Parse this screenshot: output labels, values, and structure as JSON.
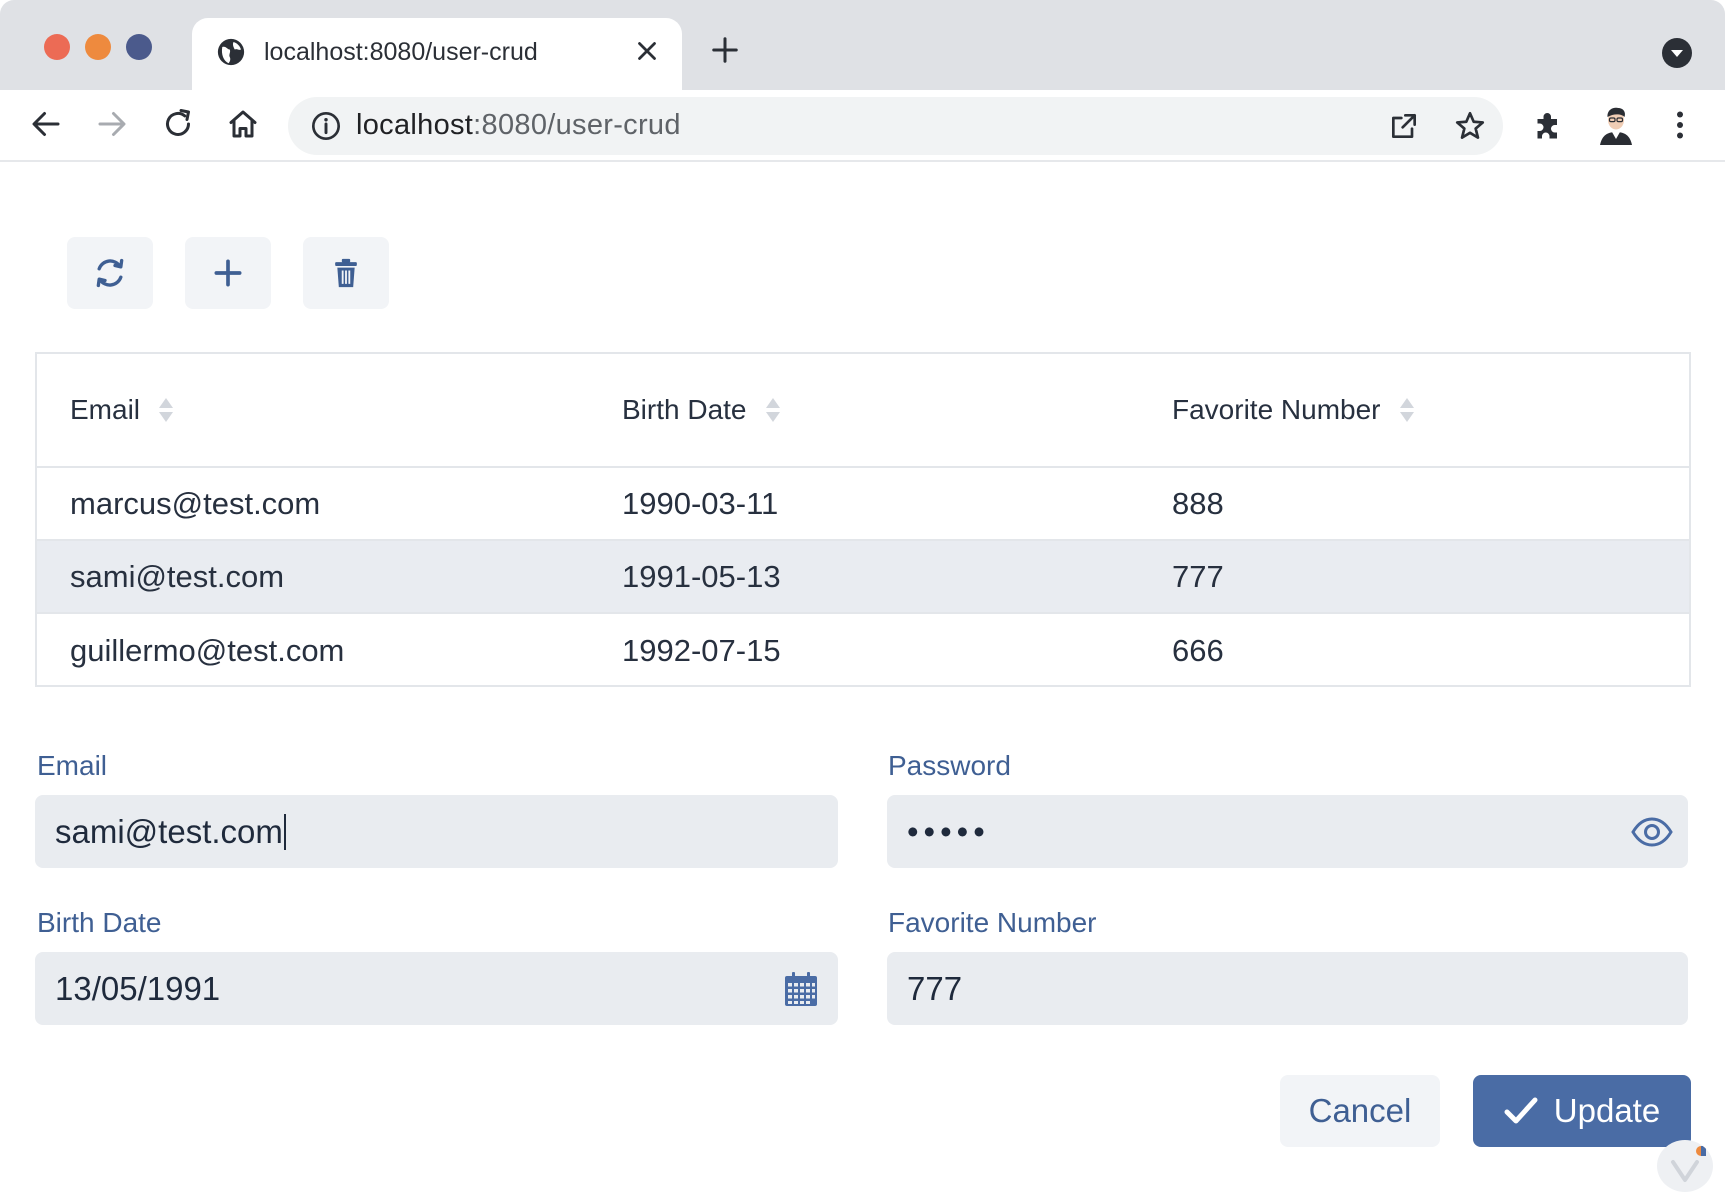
{
  "browser": {
    "tab_title": "localhost:8080/user-crud",
    "url_host": "localhost",
    "url_rest": ":8080/user-crud"
  },
  "toolbar": {
    "refresh_icon": "refresh-icon",
    "add_icon": "plus-icon",
    "delete_icon": "trash-icon"
  },
  "grid": {
    "columns": [
      "Email",
      "Birth Date",
      "Favorite Number"
    ],
    "rows": [
      {
        "email": "marcus@test.com",
        "birth_date": "1990-03-11",
        "favorite_number": "888",
        "selected": false
      },
      {
        "email": "sami@test.com",
        "birth_date": "1991-05-13",
        "favorite_number": "777",
        "selected": true
      },
      {
        "email": "guillermo@test.com",
        "birth_date": "1992-07-15",
        "favorite_number": "666",
        "selected": false
      }
    ]
  },
  "form": {
    "email_label": "Email",
    "email_value": "sami@test.com",
    "password_label": "Password",
    "password_value": "•••••",
    "birth_date_label": "Birth Date",
    "birth_date_value": "13/05/1991",
    "favorite_number_label": "Favorite Number",
    "favorite_number_value": "777",
    "cancel_label": "Cancel",
    "update_label": "Update"
  },
  "colors": {
    "accent": "#4a6ca5",
    "label": "#3f5f93",
    "selected_row": "#e9ecf1"
  }
}
